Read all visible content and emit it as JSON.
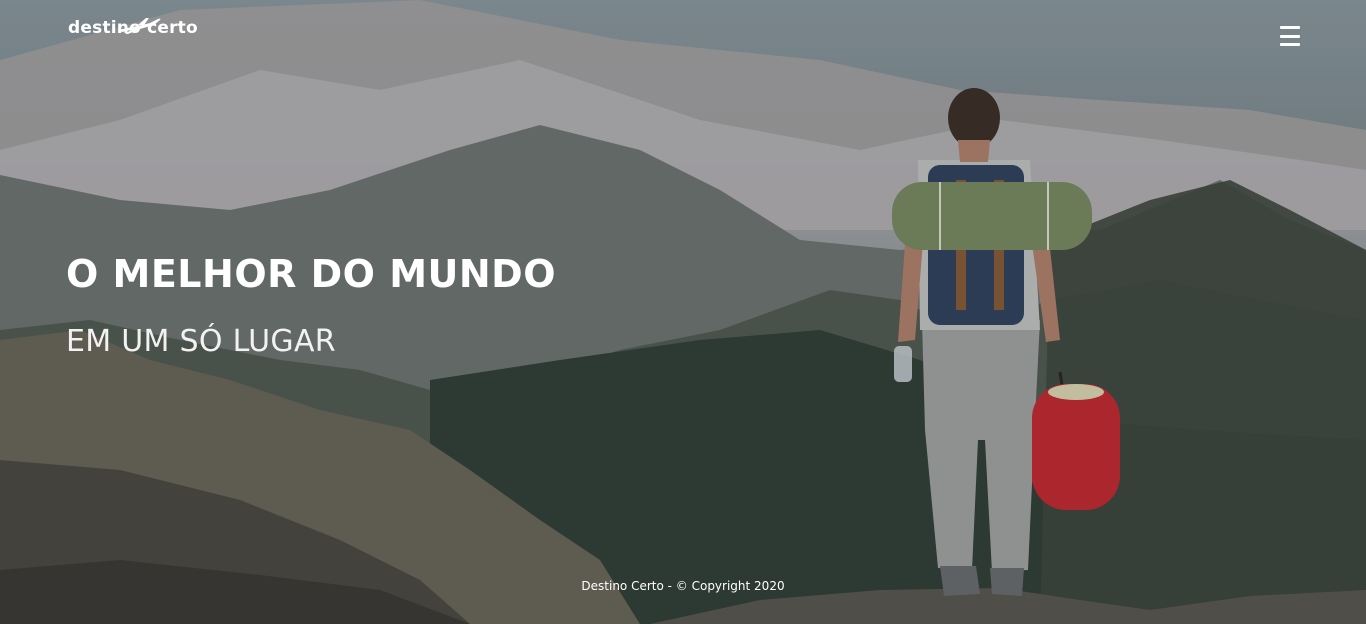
{
  "header": {
    "logo_text": "destino certo",
    "logo_icon": "airplane-icon",
    "menu_icon": "hamburger-menu-icon"
  },
  "hero": {
    "title": "O MELHOR DO MUNDO",
    "subtitle": "EM UM SÓ LUGAR",
    "image": "hiker-on-mountain-summit"
  },
  "footer": {
    "text": "Destino Certo - © Copyright 2020"
  },
  "colors": {
    "text": "#ffffff",
    "sleeping_bag": "#c8242b",
    "mat": "#7a8a5e",
    "backpack": "#2f3f5c"
  }
}
